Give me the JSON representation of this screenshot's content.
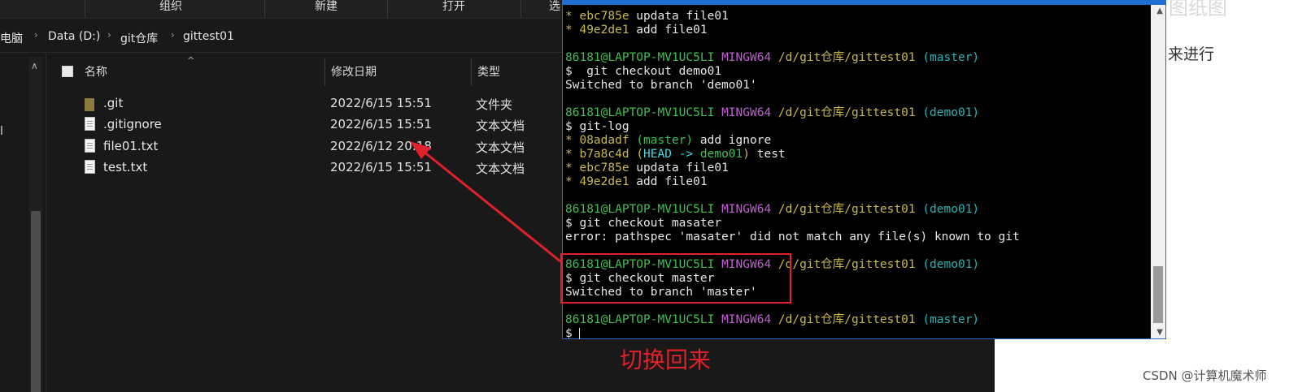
{
  "explorer": {
    "ribbon": [
      "组织",
      "新建",
      "打开",
      "选"
    ],
    "breadcrumb": [
      "电脑",
      "Data (D:)",
      "git仓库",
      "gittest01"
    ],
    "columns": {
      "name": "名称",
      "date": "修改日期",
      "type": "类型"
    },
    "files": [
      {
        "name": ".git",
        "date": "2022/6/15 15:51",
        "type": "文件夹",
        "icon": "folder-icon"
      },
      {
        "name": ".gitignore",
        "date": "2022/6/15 15:51",
        "type": "文本文档",
        "icon": "text-file-icon"
      },
      {
        "name": "file01.txt",
        "date": "2022/6/12 20:18",
        "type": "文本文档",
        "icon": "text-file-icon"
      },
      {
        "name": "test.txt",
        "date": "2022/6/15 15:51",
        "type": "文本文档",
        "icon": "text-file-icon"
      }
    ],
    "nav_stub": "l"
  },
  "terminal": {
    "prompt_user": "86181@LAPTOP-MV1UC5LI",
    "prompt_env": "MINGW64",
    "prompt_path": "/d/git仓库/gittest01",
    "lines": {
      "l1_hash": "ebc785e",
      "l1_msg": " updata file01",
      "l2_hash": "49e2de1",
      "l2_msg": " add file01",
      "b1": "(master)",
      "c1": "$  git checkout demo01",
      "o1": "Switched to branch 'demo01'",
      "b2": "(demo01)",
      "c2": "$ git-log",
      "g1_hash": "08adadf",
      "g1_ref": "(master)",
      "g1_msg": " add ignore",
      "g2_hash": "b7a8c4d",
      "g2_head": "HEAD -> ",
      "g2_branch": "demo01",
      "g2_msg": " test",
      "g3_hash": "ebc785e",
      "g3_msg": " updata file01",
      "g4_hash": "49e2de1",
      "g4_msg": " add file01",
      "b3": "(demo01)",
      "c3": "$ git checkout masater",
      "o3": "error: pathspec 'masater' did not match any file(s) known to git",
      "b4": "(demo01)",
      "c4": "$ git checkout master",
      "o4": "Switched to branch 'master'",
      "b5": "(master)",
      "c5": "$ "
    }
  },
  "annotation": {
    "text": "切换回来",
    "color": "#e0202a"
  },
  "page": {
    "fragment_top": "图纸图",
    "fragment_mid": "来进行",
    "watermark": "CSDN @计算机魔术师"
  }
}
